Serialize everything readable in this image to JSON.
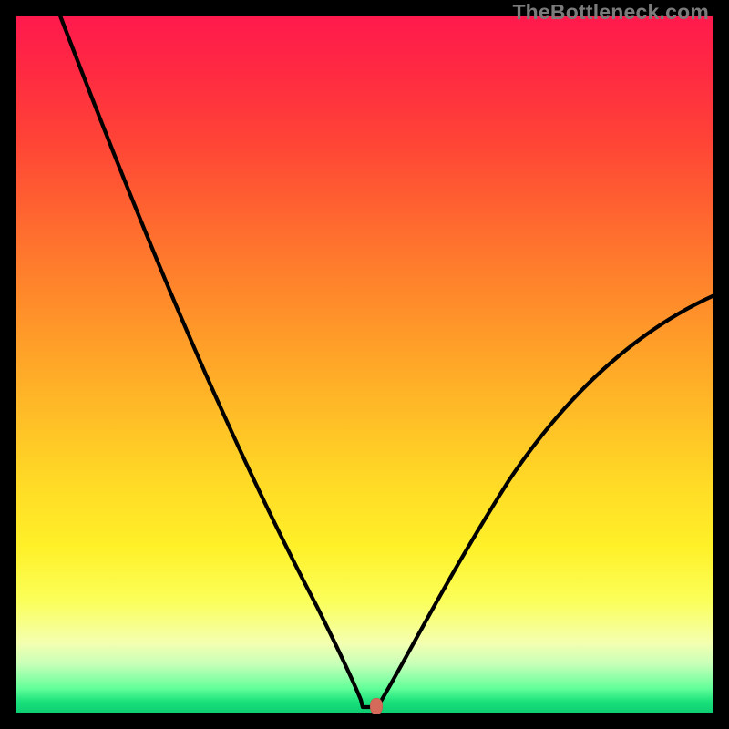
{
  "watermark": "TheBottleneck.com",
  "marker": {
    "x_frac": 0.515,
    "y_frac": 0.992
  },
  "chart_data": {
    "type": "line",
    "title": "",
    "xlabel": "",
    "ylabel": "",
    "xlim": [
      0,
      100
    ],
    "ylim": [
      0,
      100
    ],
    "series": [
      {
        "name": "bottleneck-curve",
        "x": [
          0,
          5,
          10,
          15,
          20,
          25,
          30,
          35,
          40,
          45,
          48,
          50,
          51,
          52,
          55,
          60,
          65,
          70,
          75,
          80,
          85,
          90,
          95,
          100
        ],
        "y": [
          100,
          91,
          82,
          73,
          64,
          55,
          46,
          37,
          27,
          16,
          7,
          1,
          0,
          1,
          6,
          16,
          25,
          33,
          40,
          46,
          51,
          55,
          58,
          60
        ]
      }
    ],
    "background_gradient": {
      "top": "#ff1a4d",
      "mid": "#ffe83a",
      "bottom": "#0ecf72"
    },
    "marker_point": {
      "x": 51.5,
      "y": 0.8,
      "color": "#d56a5a"
    }
  }
}
